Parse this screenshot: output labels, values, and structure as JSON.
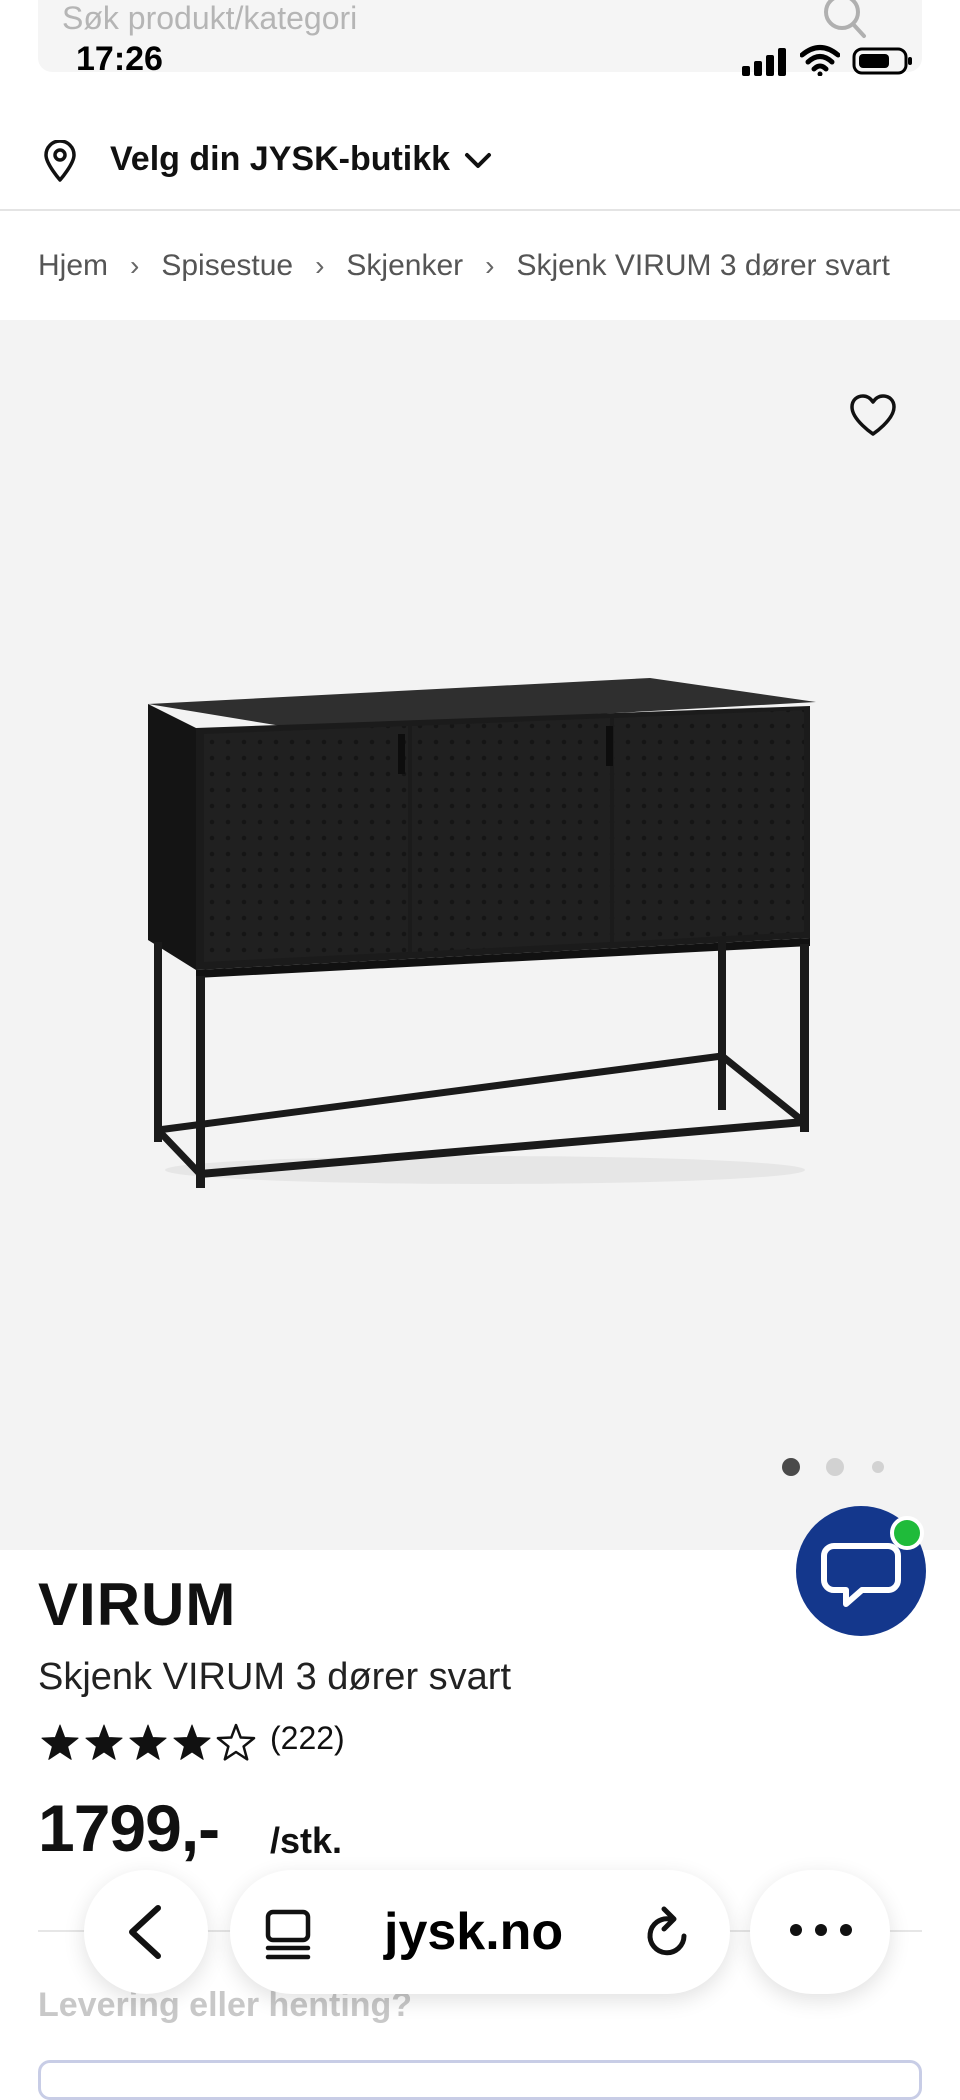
{
  "status_bar": {
    "time": "17:26"
  },
  "search": {
    "placeholder": "Søk produkt/kategori"
  },
  "store_selector": {
    "label": "Velg din JYSK-butikk"
  },
  "breadcrumb": {
    "items": [
      "Hjem",
      "Spisestue",
      "Skjenker",
      "Skjenk VIRUM 3 dører svart"
    ],
    "separator": "›"
  },
  "gallery": {
    "image_count": 3,
    "active_index": 0
  },
  "product": {
    "brand": "VIRUM",
    "name": "Skjenk VIRUM 3 dører svart",
    "rating": 4,
    "rating_max": 5,
    "review_count": "(222)",
    "price": "1799,-",
    "unit": "/stk."
  },
  "delivery": {
    "label": "Levering eller henting?"
  },
  "browser": {
    "url": "jysk.no"
  },
  "colors": {
    "chat_button": "#14378c",
    "online_dot": "#1fbb3a"
  },
  "icons": {
    "location": "pin-icon",
    "favorite": "heart-icon",
    "chat": "chat-bubble-icon"
  }
}
